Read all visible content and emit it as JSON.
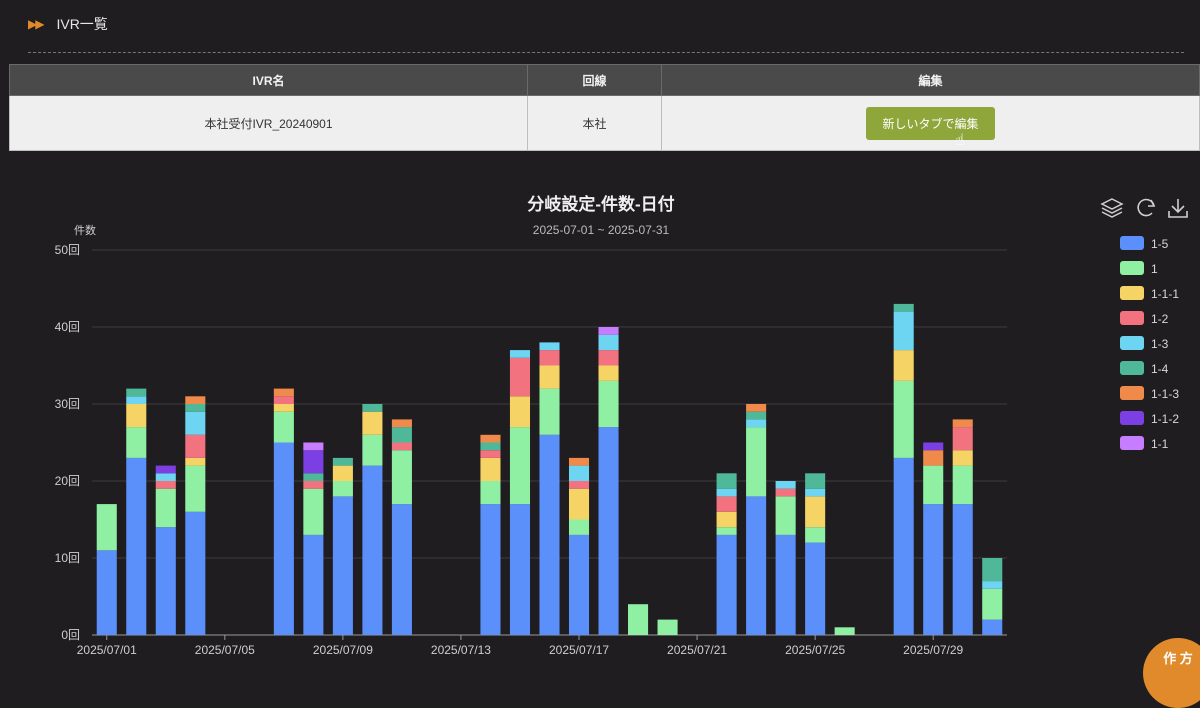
{
  "section": {
    "arrows": "▶▶",
    "title": "IVR一覧"
  },
  "table": {
    "headers": [
      "IVR名",
      "回線",
      "編集"
    ],
    "rows": [
      {
        "name": "本社受付IVR_20240901",
        "line": "本社",
        "button": "新しいタブで編集"
      }
    ]
  },
  "toolbar_icons": [
    "layers-icon",
    "refresh-icon",
    "download-icon"
  ],
  "corner_badge": "作 方",
  "chart_data": {
    "type": "bar",
    "stacked": true,
    "title": "分岐設定-件数-日付",
    "subtitle": "2025-07-01 ~ 2025-07-31",
    "ylabel": "件数",
    "y_unit": "回",
    "ylim": [
      0,
      50
    ],
    "yticks": [
      0,
      10,
      20,
      30,
      40,
      50
    ],
    "tick_labels": [
      "2025/07/01",
      "2025/07/05",
      "2025/07/09",
      "2025/07/13",
      "2025/07/17",
      "2025/07/21",
      "2025/07/25",
      "2025/07/29"
    ],
    "legend_position": "right",
    "categories": [
      "2025/07/01",
      "2025/07/02",
      "2025/07/03",
      "2025/07/04",
      "2025/07/05",
      "2025/07/06",
      "2025/07/07",
      "2025/07/08",
      "2025/07/09",
      "2025/07/10",
      "2025/07/11",
      "2025/07/12",
      "2025/07/13",
      "2025/07/14",
      "2025/07/15",
      "2025/07/16",
      "2025/07/17",
      "2025/07/18",
      "2025/07/19",
      "2025/07/20",
      "2025/07/21",
      "2025/07/22",
      "2025/07/23",
      "2025/07/24",
      "2025/07/25",
      "2025/07/26",
      "2025/07/27",
      "2025/07/28",
      "2025/07/29",
      "2025/07/30",
      "2025/07/31"
    ],
    "series": [
      {
        "name": "1-5",
        "color": "#5b8ff9",
        "values": [
          11,
          23,
          14,
          16,
          0,
          0,
          25,
          13,
          18,
          22,
          17,
          0,
          0,
          17,
          17,
          26,
          13,
          27,
          0,
          0,
          0,
          13,
          18,
          13,
          12,
          0,
          0,
          23,
          17,
          17,
          2
        ]
      },
      {
        "name": "1",
        "color": "#8ff0a4",
        "values": [
          6,
          4,
          5,
          6,
          0,
          0,
          4,
          6,
          2,
          4,
          7,
          0,
          0,
          3,
          10,
          6,
          2,
          6,
          4,
          2,
          0,
          1,
          9,
          5,
          2,
          1,
          0,
          10,
          5,
          5,
          4
        ]
      },
      {
        "name": "1-1-1",
        "color": "#f6d365",
        "values": [
          0,
          3,
          0,
          1,
          0,
          0,
          1,
          0,
          2,
          3,
          0,
          0,
          0,
          3,
          4,
          3,
          4,
          2,
          0,
          0,
          0,
          2,
          0,
          0,
          4,
          0,
          0,
          4,
          0,
          2,
          0
        ]
      },
      {
        "name": "1-2",
        "color": "#f2727f",
        "values": [
          0,
          0,
          1,
          3,
          0,
          0,
          1,
          1,
          0,
          0,
          1,
          0,
          0,
          1,
          5,
          2,
          1,
          2,
          0,
          0,
          0,
          2,
          0,
          1,
          0,
          0,
          0,
          0,
          0,
          3,
          0
        ]
      },
      {
        "name": "1-3",
        "color": "#6dd4f2",
        "values": [
          0,
          1,
          1,
          3,
          0,
          0,
          0,
          0,
          0,
          0,
          0,
          0,
          0,
          0,
          1,
          1,
          2,
          2,
          0,
          0,
          0,
          1,
          1,
          1,
          1,
          0,
          0,
          5,
          0,
          0,
          1
        ]
      },
      {
        "name": "1-4",
        "color": "#4fb898",
        "values": [
          0,
          1,
          0,
          1,
          0,
          0,
          0,
          1,
          1,
          1,
          2,
          0,
          0,
          1,
          0,
          0,
          0,
          0,
          0,
          0,
          0,
          2,
          1,
          0,
          2,
          0,
          0,
          1,
          0,
          0,
          3
        ]
      },
      {
        "name": "1-1-3",
        "color": "#f08a4b",
        "values": [
          0,
          0,
          0,
          1,
          0,
          0,
          1,
          0,
          0,
          0,
          1,
          0,
          0,
          1,
          0,
          0,
          1,
          0,
          0,
          0,
          0,
          0,
          1,
          0,
          0,
          0,
          0,
          0,
          2,
          1,
          0
        ]
      },
      {
        "name": "1-1-2",
        "color": "#7b3fe4",
        "values": [
          0,
          0,
          1,
          0,
          0,
          0,
          0,
          3,
          0,
          0,
          0,
          0,
          0,
          0,
          0,
          0,
          0,
          0,
          0,
          0,
          0,
          0,
          0,
          0,
          0,
          0,
          0,
          0,
          1,
          0,
          0
        ]
      },
      {
        "name": "1-1",
        "color": "#c77dff",
        "values": [
          0,
          0,
          0,
          0,
          0,
          0,
          0,
          1,
          0,
          0,
          0,
          0,
          0,
          0,
          0,
          0,
          0,
          1,
          0,
          0,
          0,
          0,
          0,
          0,
          0,
          0,
          0,
          0,
          0,
          0,
          0
        ]
      }
    ]
  }
}
